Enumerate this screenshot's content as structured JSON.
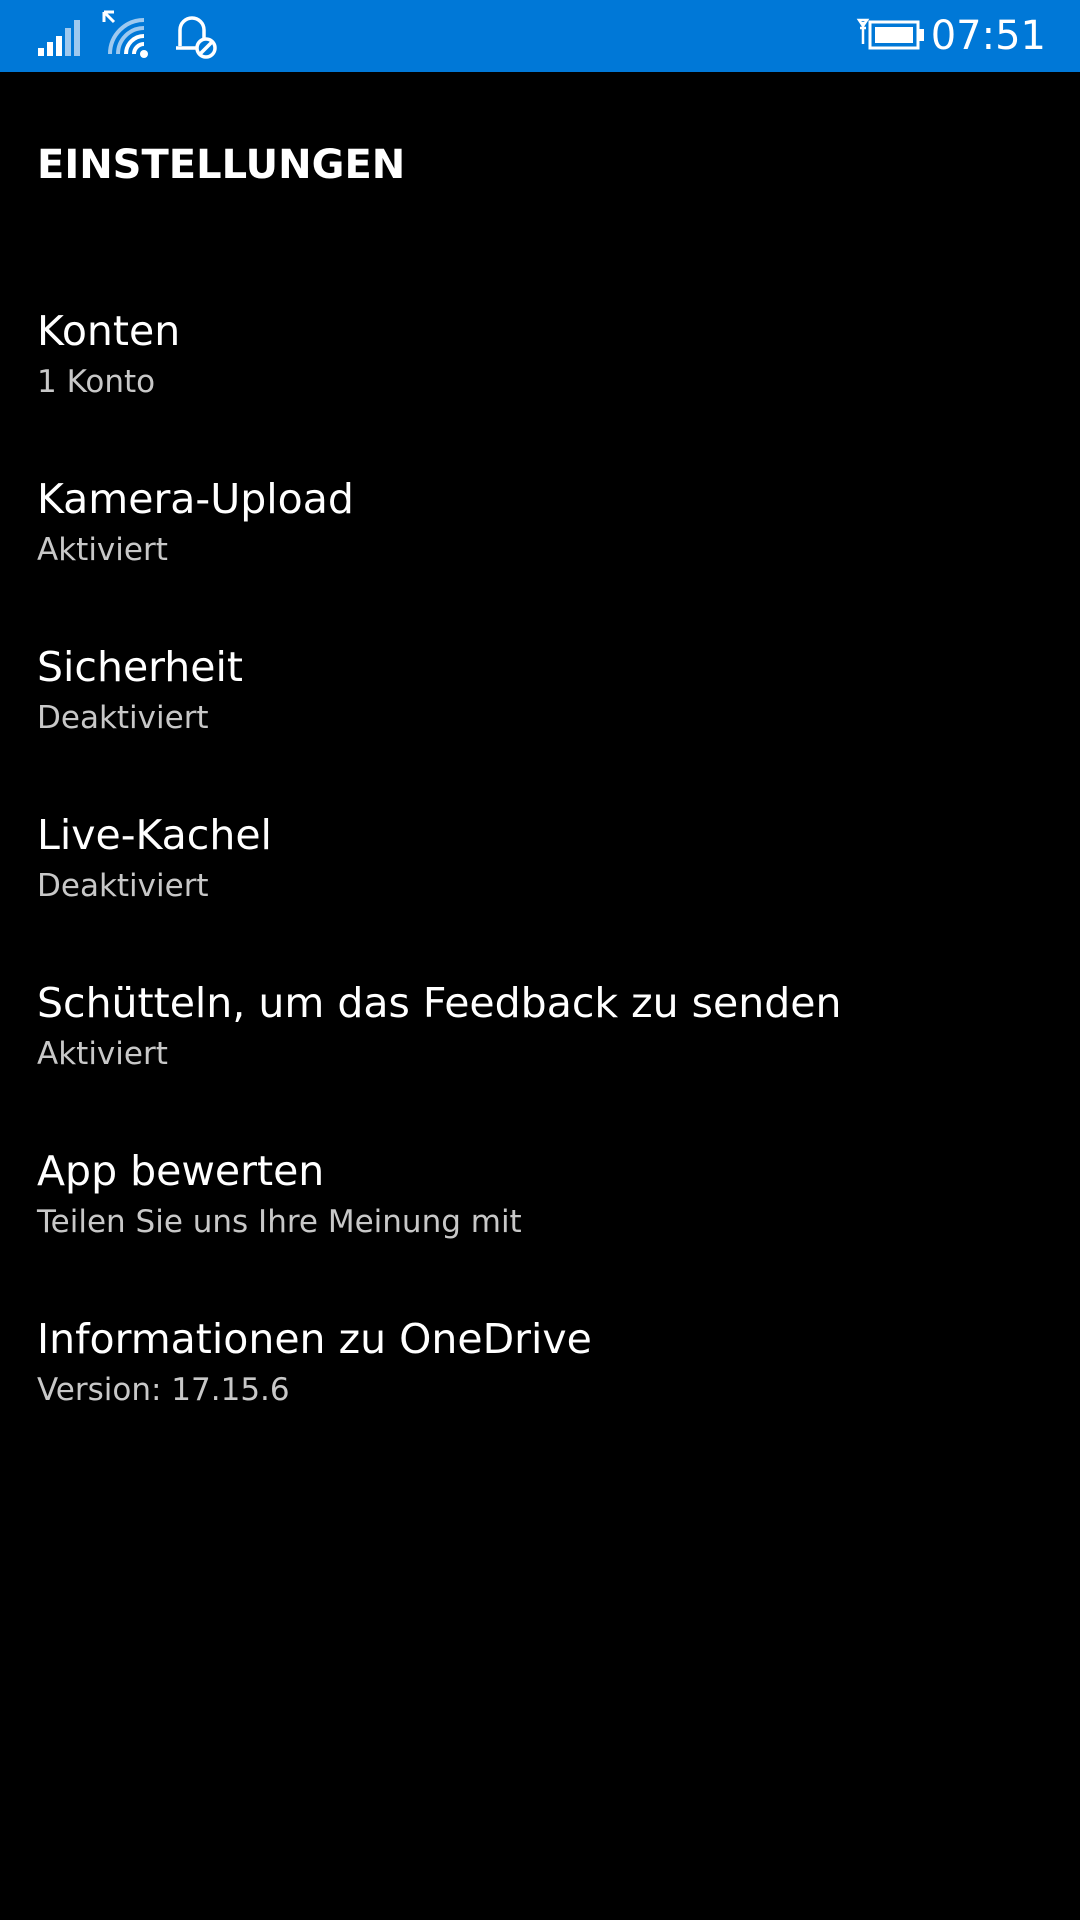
{
  "status_bar": {
    "background": "#0078d7",
    "icons": [
      "signal-icon",
      "wifi-icon",
      "alarm-off-icon",
      "battery-charging-icon"
    ],
    "time": "07:51"
  },
  "page": {
    "title": "EINSTELLUNGEN"
  },
  "settings": {
    "items": [
      {
        "title": "Konten",
        "subtitle": "1 Konto"
      },
      {
        "title": "Kamera-Upload",
        "subtitle": "Aktiviert"
      },
      {
        "title": "Sicherheit",
        "subtitle": "Deaktiviert"
      },
      {
        "title": "Live-Kachel",
        "subtitle": "Deaktiviert"
      },
      {
        "title": "Schütteln, um das Feedback zu senden",
        "subtitle": "Aktiviert"
      },
      {
        "title": "App bewerten",
        "subtitle": "Teilen Sie uns Ihre Meinung mit"
      },
      {
        "title": "Informationen zu OneDrive",
        "subtitle": "Version: 17.15.6"
      }
    ]
  }
}
